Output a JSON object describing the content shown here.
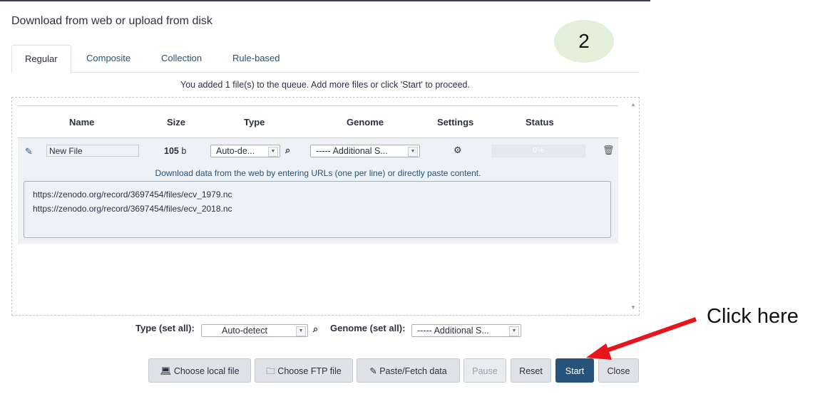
{
  "dialog": {
    "title": "Download from web or upload from disk"
  },
  "step_badge": "2",
  "tabs": [
    {
      "label": "Regular",
      "active": true
    },
    {
      "label": "Composite"
    },
    {
      "label": "Collection"
    },
    {
      "label": "Rule-based"
    }
  ],
  "queue_message": "You added 1 file(s) to the queue. Add more files or click 'Start' to proceed.",
  "table": {
    "headers": {
      "name": "Name",
      "size": "Size",
      "type": "Type",
      "genome": "Genome",
      "settings": "Settings",
      "status": "Status"
    },
    "row": {
      "name": "New File",
      "size_number": "105",
      "size_unit": "b",
      "type": "Auto-de...",
      "genome": "----- Additional S...",
      "progress": "0%",
      "hint": "Download data from the web by entering URLs (one per line) or directly paste content.",
      "urls": [
        "https://zenodo.org/record/3697454/files/ecv_1979.nc",
        "https://zenodo.org/record/3697454/files/ecv_2018.nc"
      ]
    }
  },
  "set_all": {
    "type_label": "Type (set all):",
    "type_value": "Auto-detect",
    "genome_label": "Genome (set all):",
    "genome_value": "----- Additional S..."
  },
  "buttons": {
    "choose_local": "Choose local file",
    "choose_ftp": "Choose FTP file",
    "paste_fetch": "Paste/Fetch data",
    "pause": "Pause",
    "reset": "Reset",
    "start": "Start",
    "close": "Close"
  },
  "callout": "Click here",
  "colors": {
    "primary": "#25537b",
    "arrow": "#e8141b",
    "badge": "#e3efd9"
  }
}
